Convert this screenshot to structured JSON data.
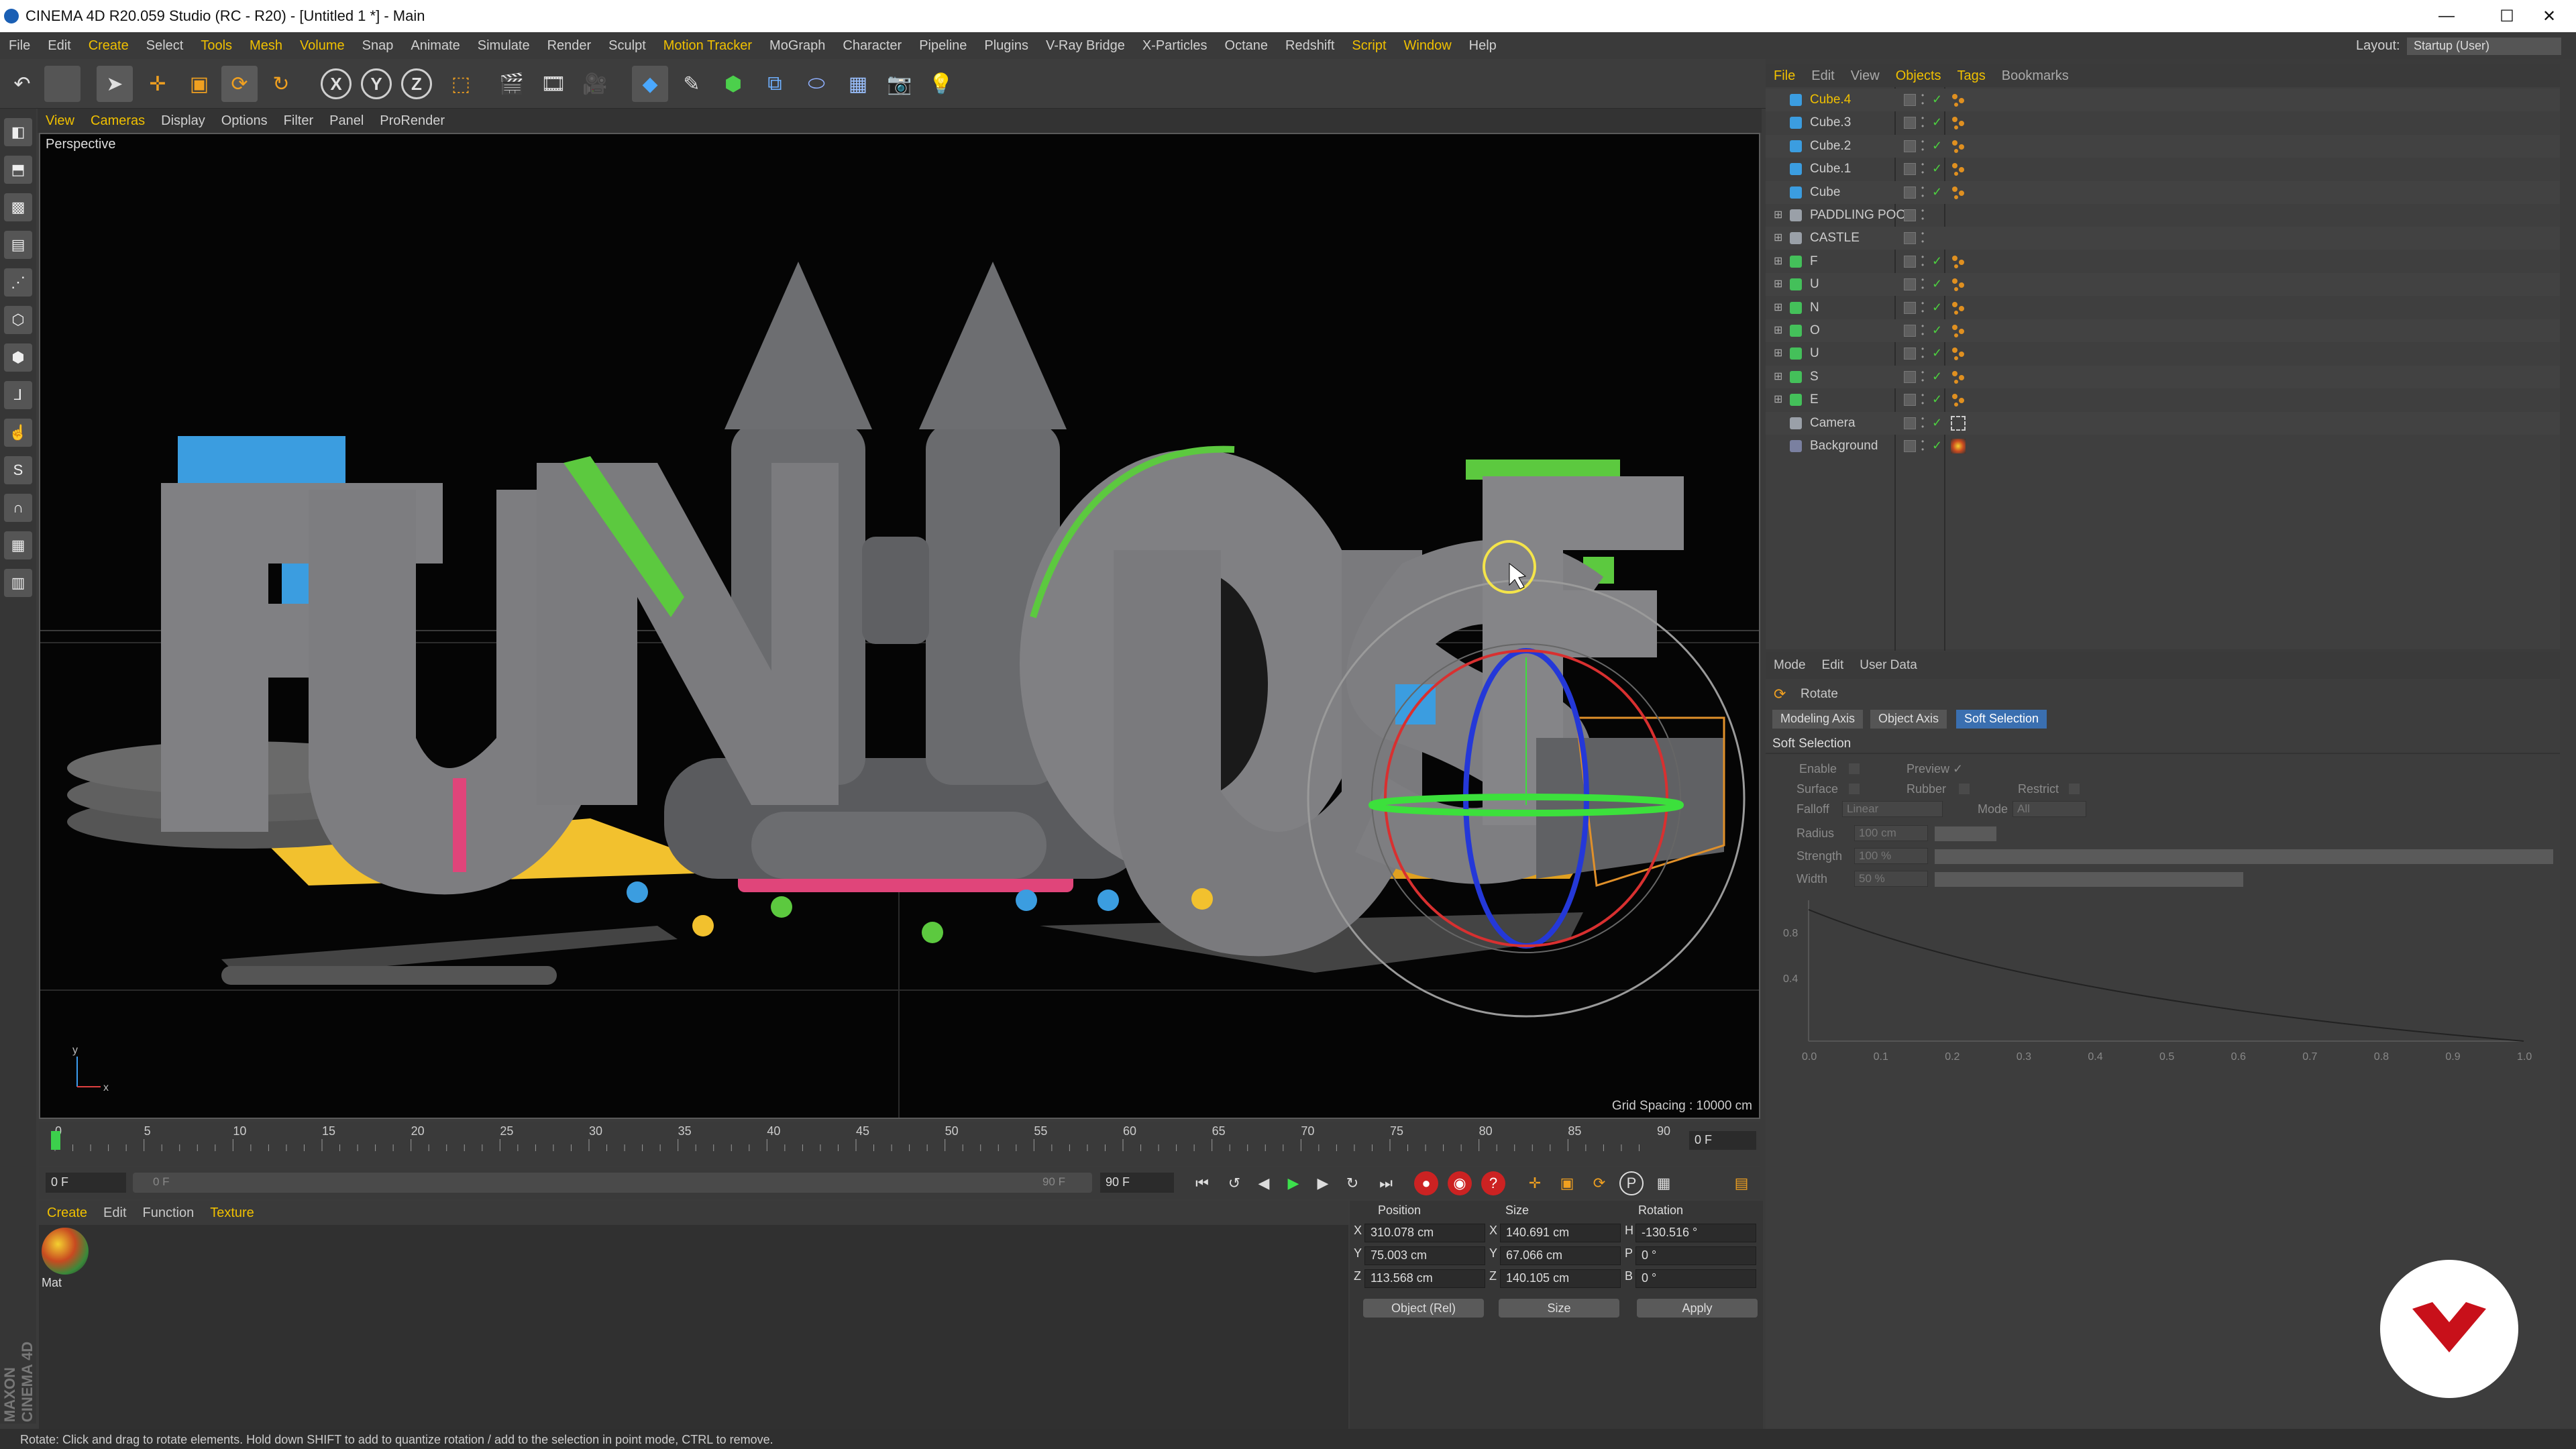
{
  "window": {
    "title": "CINEMA 4D R20.059 Studio (RC - R20) - [Untitled 1 *] - Main",
    "minimize": "—",
    "maximize": "☐",
    "close": "✕"
  },
  "menubar": {
    "items": [
      "File",
      "Edit",
      "Create",
      "Select",
      "Tools",
      "Mesh",
      "Volume",
      "Snap",
      "Animate",
      "Simulate",
      "Render",
      "Sculpt",
      "Motion Tracker",
      "MoGraph",
      "Character",
      "Pipeline",
      "Plugins",
      "V-Ray Bridge",
      "X-Particles",
      "Octane",
      "Redshift",
      "Script",
      "Window",
      "Help"
    ],
    "highlighted": [
      "Create",
      "Tools",
      "Mesh",
      "Volume",
      "Motion Tracker",
      "Script",
      "Window"
    ],
    "layout_label": "Layout:",
    "layout_value": "Startup (User)"
  },
  "toolbar": {
    "undo_icon": "undo-icon",
    "axis_x": "X",
    "axis_y": "Y",
    "axis_z": "Z"
  },
  "viewport": {
    "menu": [
      "View",
      "Cameras",
      "Display",
      "Options",
      "Filter",
      "Panel",
      "ProRender"
    ],
    "label": "Perspective",
    "grid_spacing": "Grid Spacing : 10000 cm",
    "axis_y": "y",
    "axis_x": "x",
    "colors": {
      "cube_blue": "#3b9de0",
      "green": "#5cc93f",
      "pink": "#e0457a",
      "yellow": "#f2c12e",
      "letters": "#7a7a7c"
    }
  },
  "timeline": {
    "ticks": [
      "0",
      "5",
      "10",
      "15",
      "20",
      "25",
      "30",
      "35",
      "40",
      "45",
      "50",
      "55",
      "60",
      "65",
      "70",
      "75",
      "80",
      "85",
      "90"
    ],
    "current_frame": "0 F",
    "start_field": "0 F",
    "end_field": "90 F",
    "slider_left": "0 F",
    "slider_right": "90 F"
  },
  "materials": {
    "menu": [
      "Create",
      "Edit",
      "Function",
      "Texture"
    ],
    "highlighted": [
      "Create",
      "Texture"
    ],
    "items": [
      {
        "name": "Mat"
      }
    ]
  },
  "coords": {
    "headers": {
      "position": "Position",
      "size": "Size",
      "rotation": "Rotation"
    },
    "rows": [
      {
        "axis": "X",
        "pos": "310.078 cm",
        "size_axis": "X",
        "size": "140.691 cm",
        "rot_axis": "H",
        "rot": "-130.516 °"
      },
      {
        "axis": "Y",
        "pos": "75.003 cm",
        "size_axis": "Y",
        "size": "67.066 cm",
        "rot_axis": "P",
        "rot": "0 °"
      },
      {
        "axis": "Z",
        "pos": "113.568 cm",
        "size_axis": "Z",
        "size": "140.105 cm",
        "rot_axis": "B",
        "rot": "0 °"
      }
    ],
    "mode_dropdown": "Object (Rel)",
    "size_dropdown": "Size",
    "apply": "Apply"
  },
  "object_manager": {
    "menu": [
      "File",
      "Edit",
      "View",
      "Objects",
      "Tags",
      "Bookmarks"
    ],
    "highlighted": [
      "File",
      "Objects",
      "Tags"
    ],
    "objects": [
      {
        "name": "Cube.4",
        "type": "cube",
        "selected": true
      },
      {
        "name": "Cube.3",
        "type": "cube"
      },
      {
        "name": "Cube.2",
        "type": "cube"
      },
      {
        "name": "Cube.1",
        "type": "cube"
      },
      {
        "name": "Cube",
        "type": "cube"
      },
      {
        "name": "PADDLING POO",
        "type": "null",
        "expand": true
      },
      {
        "name": "CASTLE",
        "type": "null",
        "expand": true
      },
      {
        "name": "F",
        "type": "text",
        "expand": true
      },
      {
        "name": "U",
        "type": "text",
        "expand": true
      },
      {
        "name": "N",
        "type": "text",
        "expand": true
      },
      {
        "name": "O",
        "type": "text",
        "expand": true
      },
      {
        "name": "U",
        "type": "text",
        "expand": true
      },
      {
        "name": "S",
        "type": "text",
        "expand": true
      },
      {
        "name": "E",
        "type": "text",
        "expand": true
      },
      {
        "name": "Camera",
        "type": "camera"
      },
      {
        "name": "Background",
        "type": "background"
      }
    ]
  },
  "attribute_manager": {
    "menu": [
      "Mode",
      "Edit",
      "User Data"
    ],
    "title": "Rotate",
    "tabs": [
      "Modeling Axis",
      "Object Axis",
      "Soft Selection"
    ],
    "active_tab": "Soft Selection",
    "section": "Soft Selection",
    "fields": {
      "enable": "Enable",
      "preview": "Preview ✓",
      "surface": "Surface",
      "rubber": "Rubber",
      "restrict": "Restrict",
      "falloff": "Falloff",
      "falloff_value": "Linear",
      "mode": "Mode",
      "mode_value": "All",
      "radius": "Radius",
      "radius_value": "100 cm",
      "strength": "Strength",
      "strength_value": "100 %",
      "width": "Width",
      "width_value": "50 %"
    },
    "graph_y": [
      "0.8",
      "0.4"
    ],
    "graph_x": [
      "0.0",
      "0.1",
      "0.2",
      "0.3",
      "0.4",
      "0.5",
      "0.6",
      "0.7",
      "0.8",
      "0.9",
      "1.0"
    ]
  },
  "side_brand": "MAXON CINEMA 4D",
  "statusbar": "Rotate: Click and drag to rotate elements. Hold down SHIFT to add to quantize rotation / add to the selection in point mode, CTRL to remove."
}
